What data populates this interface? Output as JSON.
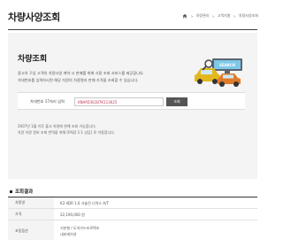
{
  "header": {
    "title": "차량사양조회",
    "breadcrumb": [
      "차량관리",
      "고객지원",
      "차량사양조회"
    ]
  },
  "search_panel": {
    "heading": "차량조회",
    "description_lines": [
      "중고차 구입 고객의 차량사양 계약 시 판매를 위해 사용 조회 서비스를 제공합니다.",
      "차대번호를 입력하시면 해당 차량의 차종명과 판매 가격을 조회할 수 있습니다."
    ],
    "illustration_label": "SEARCH",
    "field_label": "차대번호 17자리 입력",
    "field_value": "KNAPZ4S1B7K113625",
    "button_label": "조회",
    "notice_lines": [
      "2007년 1월 이후 출고 차량에 한해 조회 가능합니다.",
      "차량 차량 정보 조회 번역을 위해 [FAQ] 1:1 상담] 로 이용합니다."
    ]
  },
  "results": {
    "title": "조회결과",
    "rows": [
      {
        "label": "차종명",
        "values": [
          "K3 4DR 1.6 가솔린 디럭스 A/T"
        ]
      },
      {
        "label": "가격",
        "values": [
          "22,190,000 원"
        ]
      },
      {
        "label": "포함옵션",
        "values": [
          "기본형 / 도어가드프로텍츠",
          "내비게이션"
        ]
      }
    ]
  },
  "colors": {
    "accent": "#c23050",
    "panel_bg": "#f4f4f4",
    "button_bg": "#555555"
  }
}
